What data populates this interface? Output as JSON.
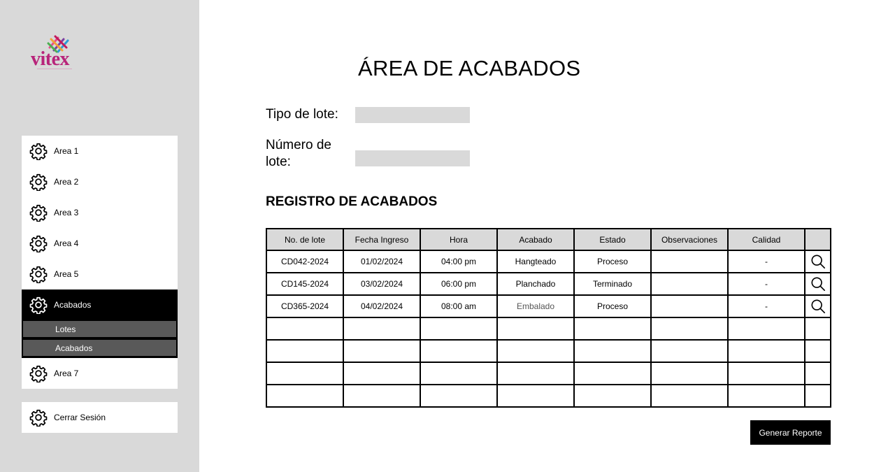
{
  "brand": {
    "name": "vitex",
    "color": "#b8237a"
  },
  "sidebar": {
    "items": [
      {
        "label": "Area 1",
        "icon": "gear-icon"
      },
      {
        "label": "Area 2",
        "icon": "gear-icon"
      },
      {
        "label": "Area 3",
        "icon": "gear-icon"
      },
      {
        "label": "Area 4",
        "icon": "gear-icon"
      },
      {
        "label": "Area 5",
        "icon": "gear-icon"
      },
      {
        "label": "Acabados",
        "icon": "gear-icon",
        "active": true,
        "submenu": [
          {
            "label": "Lotes"
          },
          {
            "label": "Acabados"
          }
        ]
      },
      {
        "label": "Area 7",
        "icon": "gear-icon"
      }
    ],
    "logout": {
      "label": "Cerrar Sesión",
      "icon": "gear-icon"
    }
  },
  "main": {
    "title": "ÁREA DE ACABADOS",
    "form": {
      "tipo_lote_label": "Tipo de lote:",
      "tipo_lote_value": "",
      "numero_lote_label": "Número de lote:",
      "numero_lote_value": ""
    },
    "section_title": "REGISTRO DE ACABADOS",
    "table": {
      "headers": [
        "No. de lote",
        "Fecha Ingreso",
        "Hora",
        "Acabado",
        "Estado",
        "Observaciones",
        "Calidad",
        ""
      ],
      "rows": [
        [
          "CD042-2024",
          "01/02/2024",
          "04:00 pm",
          "Hangteado",
          "Proceso",
          "",
          "-"
        ],
        [
          "CD145-2024",
          "03/02/2024",
          "06:00 pm",
          "Planchado",
          "Terminado",
          "",
          "-"
        ],
        [
          "CD365-2024",
          "04/02/2024",
          "08:00 am",
          "Embalado",
          "Proceso",
          "",
          "-"
        ],
        [
          "",
          "",
          "",
          "",
          "",
          "",
          ""
        ],
        [
          "",
          "",
          "",
          "",
          "",
          "",
          ""
        ],
        [
          "",
          "",
          "",
          "",
          "",
          "",
          ""
        ],
        [
          "",
          "",
          "",
          "",
          "",
          "",
          ""
        ]
      ],
      "action_icon": "search-icon"
    },
    "report_button": "Generar Reporte"
  },
  "colors": {
    "sidebar_bg": "#d9d9d9",
    "active_bg": "#000000",
    "submenu_bg": "#595959",
    "input_bg": "#d9d9d9"
  }
}
